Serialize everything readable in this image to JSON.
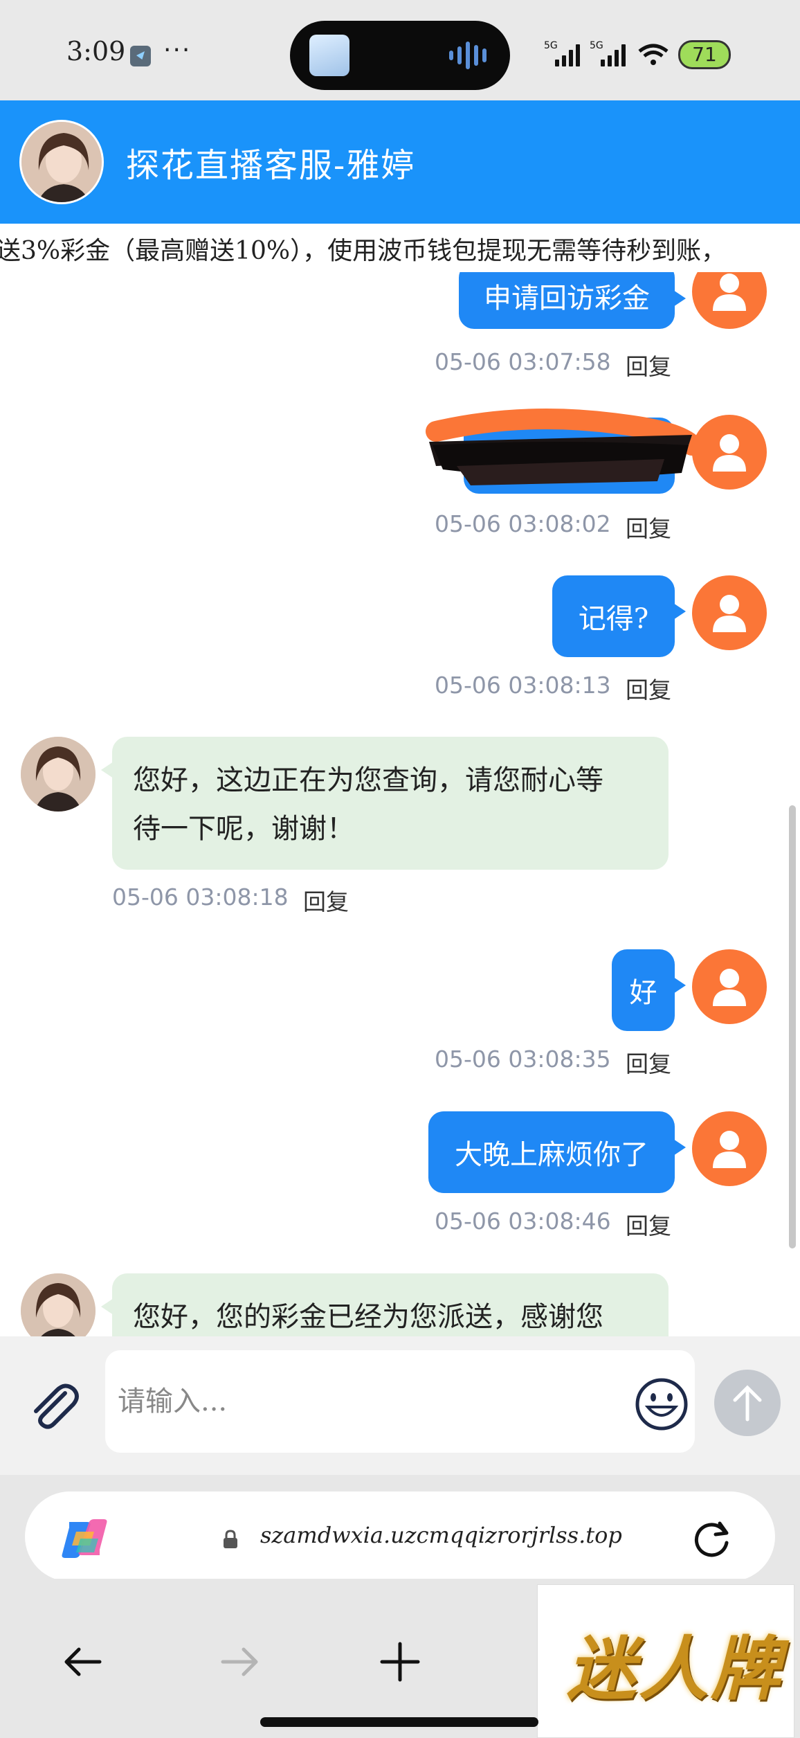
{
  "status_bar": {
    "time": "3:09",
    "dots": "···",
    "signal1_label": "5G",
    "signal2_label": "5G",
    "battery_level": "71"
  },
  "header": {
    "title": "探花直播客服-雅婷",
    "accent_color": "#1a93fa"
  },
  "marquee": {
    "text": "送3%彩金（最高赠送10%），使用波币钱包提现无需等待秒到账，"
  },
  "messages": [
    {
      "side": "out",
      "text": "申请回访彩金",
      "time": "05-06 03:07:58",
      "reply": "回复"
    },
    {
      "side": "out",
      "text": "",
      "redacted": true,
      "time": "05-06 03:08:02",
      "reply": "回复"
    },
    {
      "side": "out",
      "text": "记得?",
      "time": "05-06 03:08:13",
      "reply": "回复"
    },
    {
      "side": "in",
      "lines": [
        "您好，这边正在为您查询，请您耐心等",
        "待一下呢，谢谢！"
      ],
      "time": "05-06 03:08:18",
      "reply": "回复"
    },
    {
      "side": "out",
      "text": "好",
      "time": "05-06 03:08:35",
      "reply": "回复"
    },
    {
      "side": "out",
      "text": "大晚上麻烦你了",
      "time": "05-06 03:08:46",
      "reply": "回复"
    },
    {
      "side": "in",
      "lines": [
        "您好，您的彩金已经为您派送，感谢您"
      ],
      "time": "",
      "reply": ""
    }
  ],
  "input": {
    "placeholder": "请输入..."
  },
  "browser": {
    "url": "szamdwxia.uzcmqqizrorjrlss.top"
  },
  "watermark": {
    "text": "迷人牌"
  },
  "colors": {
    "out_bubble": "#1f88f5",
    "in_bubble": "#e3f1e3",
    "user_avatar": "#fb7637",
    "timestamp": "#8e96a8"
  }
}
